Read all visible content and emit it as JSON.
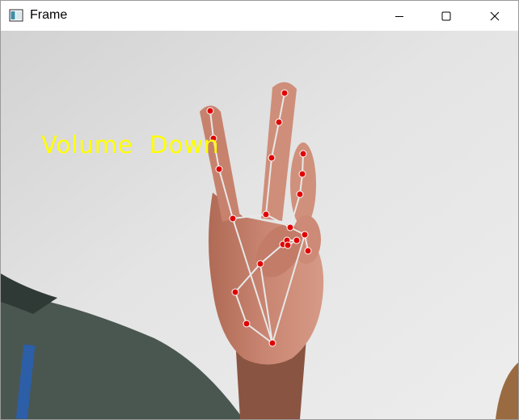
{
  "window": {
    "title": "Frame",
    "icon": "app-window-icon",
    "controls": [
      "minimize-icon",
      "maximize-icon",
      "close-icon"
    ]
  },
  "frame": {
    "overlay_text": "Volume  Down",
    "overlay_color": "#ffff00",
    "landmark_color": "#e00000",
    "connection_color": "#e8e8e8"
  }
}
